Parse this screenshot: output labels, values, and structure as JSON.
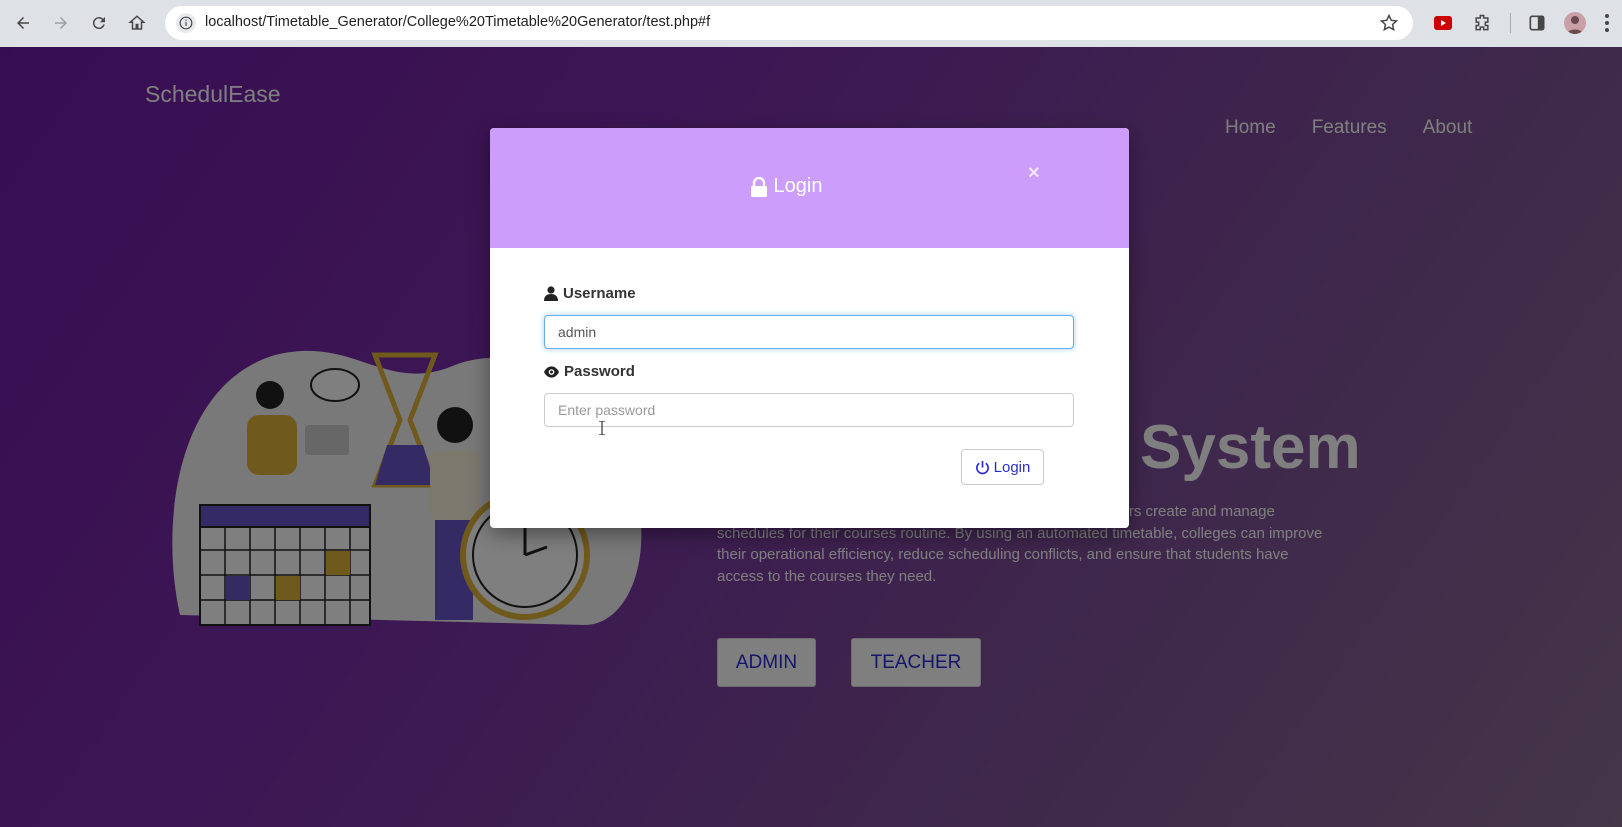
{
  "browser": {
    "url": "localhost/Timetable_Generator/College%20Timetable%20Generator/test.php#f",
    "back_icon": "back-arrow-icon",
    "forward_icon": "forward-arrow-icon",
    "reload_icon": "reload-icon",
    "home_icon": "home-icon"
  },
  "site": {
    "brand": "SchedulEase",
    "nav": [
      "Home",
      "Features",
      "About"
    ],
    "hero_title": "System",
    "hero_description": "An Semi-automated timetable Management System helps users create and manage schedules for their courses routine. By using an automated timetable, colleges can improve their operational efficiency, reduce scheduling conflicts, and ensure that students have access to the courses they need.",
    "admin_button": "ADMIN",
    "teacher_button": "TEACHER"
  },
  "modal": {
    "title": "Login",
    "close_label": "×",
    "username_label": "Username",
    "username_value": "admin",
    "password_label": "Password",
    "password_placeholder": "Enter password",
    "login_button": "Login"
  },
  "colors": {
    "modal_header": "#cd9dfb",
    "page_purple": "#6f1ba5",
    "button_text": "#2b2bd3"
  }
}
